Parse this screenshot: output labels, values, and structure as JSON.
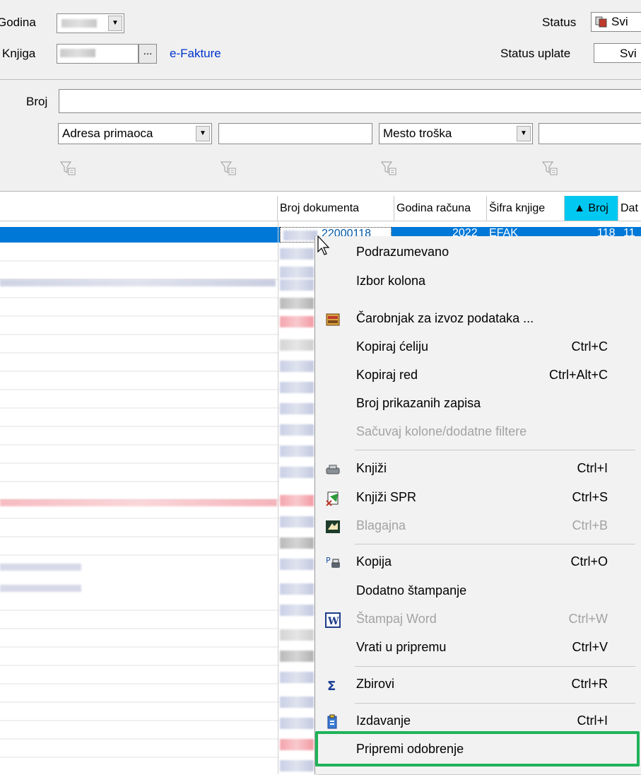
{
  "filters": {
    "godina_label": "Godina",
    "knjiga_label": "Knjiga",
    "ellipsis": "...",
    "efakture_link": "e-Fakture",
    "status_label": "Status",
    "status_value": "Svi",
    "status_uplate_label": "Status uplate",
    "status_uplate_value": "Svi",
    "broj_label": "Broj",
    "combo1_value": "Adresa primaoca",
    "combo2_value": "Mesto troška"
  },
  "grid": {
    "columns": [
      "Broj dokumenta",
      "Godina računa",
      "Šifra knjige",
      "▲ Broj",
      "Dat"
    ],
    "selected_row": {
      "broj_dokumenta": "22000118",
      "godina": "2022",
      "sifra": "EFAK",
      "broj": "118",
      "dat": "11"
    }
  },
  "context_menu": {
    "items": [
      {
        "label": "Podrazumevano",
        "shortcut": "",
        "disabled": false,
        "icon": ""
      },
      {
        "label": "Izbor kolona",
        "shortcut": "",
        "disabled": false,
        "icon": ""
      },
      {
        "label": "Čarobnjak za izvoz podataka ...",
        "shortcut": "",
        "disabled": false,
        "icon": "export-wizard-icon"
      },
      {
        "label": "Kopiraj ćeliju",
        "shortcut": "Ctrl+C",
        "disabled": false,
        "icon": ""
      },
      {
        "label": "Kopiraj red",
        "shortcut": "Ctrl+Alt+C",
        "disabled": false,
        "icon": ""
      },
      {
        "label": "Broj prikazanih zapisa",
        "shortcut": "",
        "disabled": false,
        "icon": ""
      },
      {
        "label": "Sačuvaj kolone/dodatne filtere",
        "shortcut": "",
        "disabled": true,
        "icon": ""
      },
      {
        "label": "Knjiži",
        "shortcut": "Ctrl+I",
        "disabled": false,
        "icon": "post-icon"
      },
      {
        "label": "Knjiži SPR",
        "shortcut": "Ctrl+S",
        "disabled": false,
        "icon": "post-spr-icon"
      },
      {
        "label": "Blagajna",
        "shortcut": "Ctrl+B",
        "disabled": true,
        "icon": "cash-register-icon"
      },
      {
        "label": "Kopija",
        "shortcut": "Ctrl+O",
        "disabled": false,
        "icon": "copy-print-icon"
      },
      {
        "label": "Dodatno štampanje",
        "shortcut": "",
        "disabled": false,
        "icon": ""
      },
      {
        "label": "Štampaj Word",
        "shortcut": "Ctrl+W",
        "disabled": true,
        "icon": "word-icon"
      },
      {
        "label": "Vrati u pripremu",
        "shortcut": "Ctrl+V",
        "disabled": false,
        "icon": ""
      },
      {
        "label": "Zbirovi",
        "shortcut": "Ctrl+R",
        "disabled": false,
        "icon": "sigma-icon"
      },
      {
        "label": "Izdavanje",
        "shortcut": "Ctrl+I",
        "disabled": false,
        "icon": "issue-icon"
      },
      {
        "label": "Pripremi odobrenje",
        "shortcut": "",
        "disabled": false,
        "icon": ""
      }
    ]
  },
  "colors": {
    "selection": "#0078d7",
    "highlight_box": "#1fb35a",
    "link": "#0033cc",
    "sorted_header": "#00c8f0"
  }
}
